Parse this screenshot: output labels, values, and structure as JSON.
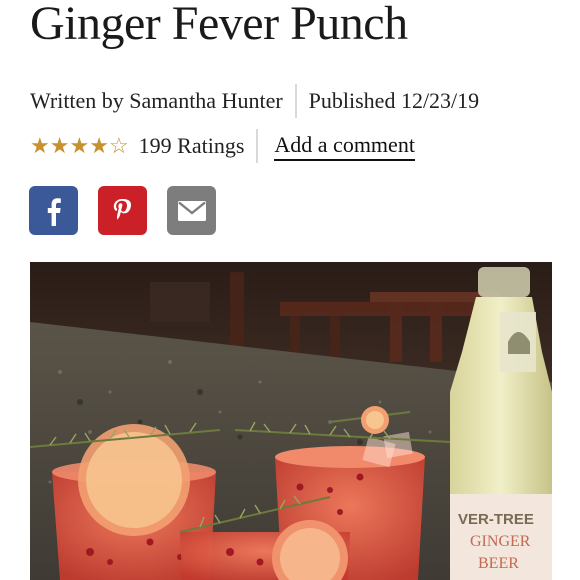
{
  "recipe": {
    "title": "Ginger Fever Punch",
    "author_line": "Written by Samantha Hunter",
    "published_line": "Published 12/23/19"
  },
  "rating": {
    "stars": 4,
    "max_stars": 5,
    "ratings_text": "199 Ratings",
    "comment_link": "Add a comment"
  },
  "share": {
    "buttons": [
      {
        "name": "facebook",
        "icon": "facebook-icon",
        "color": "#3b5998"
      },
      {
        "name": "pinterest",
        "icon": "pinterest-icon",
        "color": "#cb2027"
      },
      {
        "name": "email",
        "icon": "mail-icon",
        "color": "#7d7d7d"
      }
    ]
  },
  "photo": {
    "bottle_label_lines": [
      "VER-TREE",
      "GINGER",
      "BEER"
    ]
  },
  "colors": {
    "star": "#c8912f",
    "divider": "#d9d9d9"
  }
}
